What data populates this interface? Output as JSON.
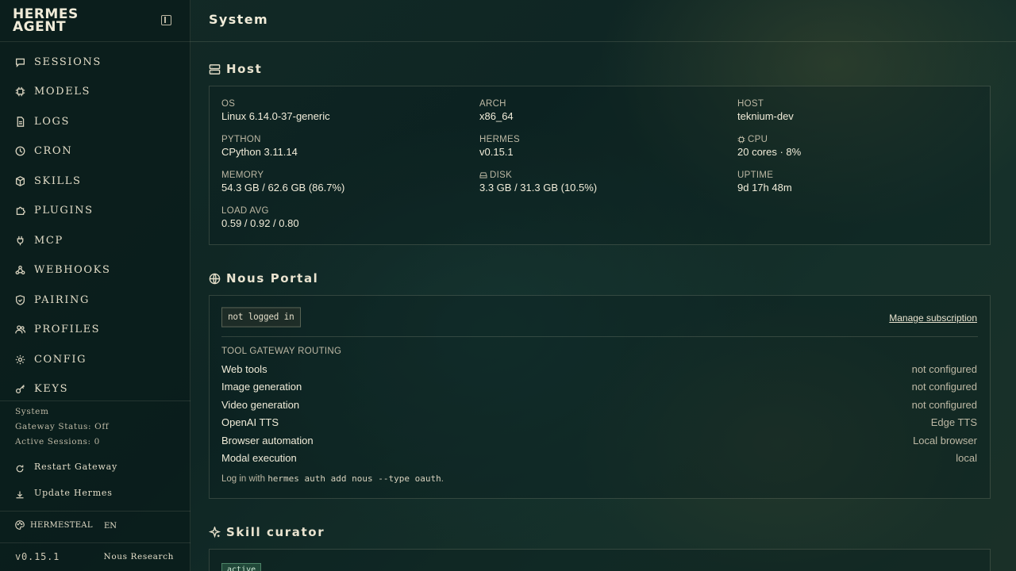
{
  "brand": {
    "line1": "HERMES",
    "line2": "AGENT"
  },
  "nav": [
    {
      "label": "SESSIONS",
      "icon": "chat-icon"
    },
    {
      "label": "MODELS",
      "icon": "chip-icon"
    },
    {
      "label": "LOGS",
      "icon": "file-icon"
    },
    {
      "label": "CRON",
      "icon": "clock-icon"
    },
    {
      "label": "SKILLS",
      "icon": "package-icon"
    },
    {
      "label": "PLUGINS",
      "icon": "puzzle-icon"
    },
    {
      "label": "MCP",
      "icon": "plug-icon"
    },
    {
      "label": "WEBHOOKS",
      "icon": "webhook-icon"
    },
    {
      "label": "PAIRING",
      "icon": "shield-icon"
    },
    {
      "label": "PROFILES",
      "icon": "users-icon"
    },
    {
      "label": "CONFIG",
      "icon": "gear-icon"
    },
    {
      "label": "KEYS",
      "icon": "key-icon"
    }
  ],
  "status": {
    "section": "System",
    "gateway": "Gateway Status: Off",
    "sessions": "Active Sessions: 0"
  },
  "actions": {
    "restart": "Restart Gateway",
    "update": "Update Hermes"
  },
  "footer": {
    "theme": "HERMESTEAL",
    "lang": "EN",
    "version": "v0.15.1",
    "vendor": "Nous Research"
  },
  "page": {
    "title": "System"
  },
  "host": {
    "title": "Host",
    "os_label": "OS",
    "os": "Linux 6.14.0-37-generic",
    "arch_label": "ARCH",
    "arch": "x86_64",
    "host_label": "HOST",
    "host": "teknium-dev",
    "python_label": "PYTHON",
    "python": "CPython 3.11.14",
    "hermes_label": "HERMES",
    "hermes": "v0.15.1",
    "cpu_label": "CPU",
    "cpu": "20 cores · 8%",
    "memory_label": "MEMORY",
    "memory": "54.3 GB / 62.6 GB (86.7%)",
    "disk_label": "DISK",
    "disk": "3.3 GB / 31.3 GB (10.5%)",
    "uptime_label": "UPTIME",
    "uptime": "9d 17h 48m",
    "load_label": "LOAD AVG",
    "load": "0.59 / 0.92 / 0.80"
  },
  "portal": {
    "title": "Nous Portal",
    "status": "not logged in",
    "manage": "Manage subscription",
    "gateway_title": "TOOL GATEWAY ROUTING",
    "routes": [
      {
        "name": "Web tools",
        "value": "not configured"
      },
      {
        "name": "Image generation",
        "value": "not configured"
      },
      {
        "name": "Video generation",
        "value": "not configured"
      },
      {
        "name": "OpenAI TTS",
        "value": "Edge TTS"
      },
      {
        "name": "Browser automation",
        "value": "Local browser"
      },
      {
        "name": "Modal execution",
        "value": "local"
      }
    ],
    "hint_pre": "Log in with ",
    "hint_code": "hermes auth add nous --type oauth",
    "hint_post": "."
  },
  "curator": {
    "title": "Skill curator",
    "status": "active"
  }
}
